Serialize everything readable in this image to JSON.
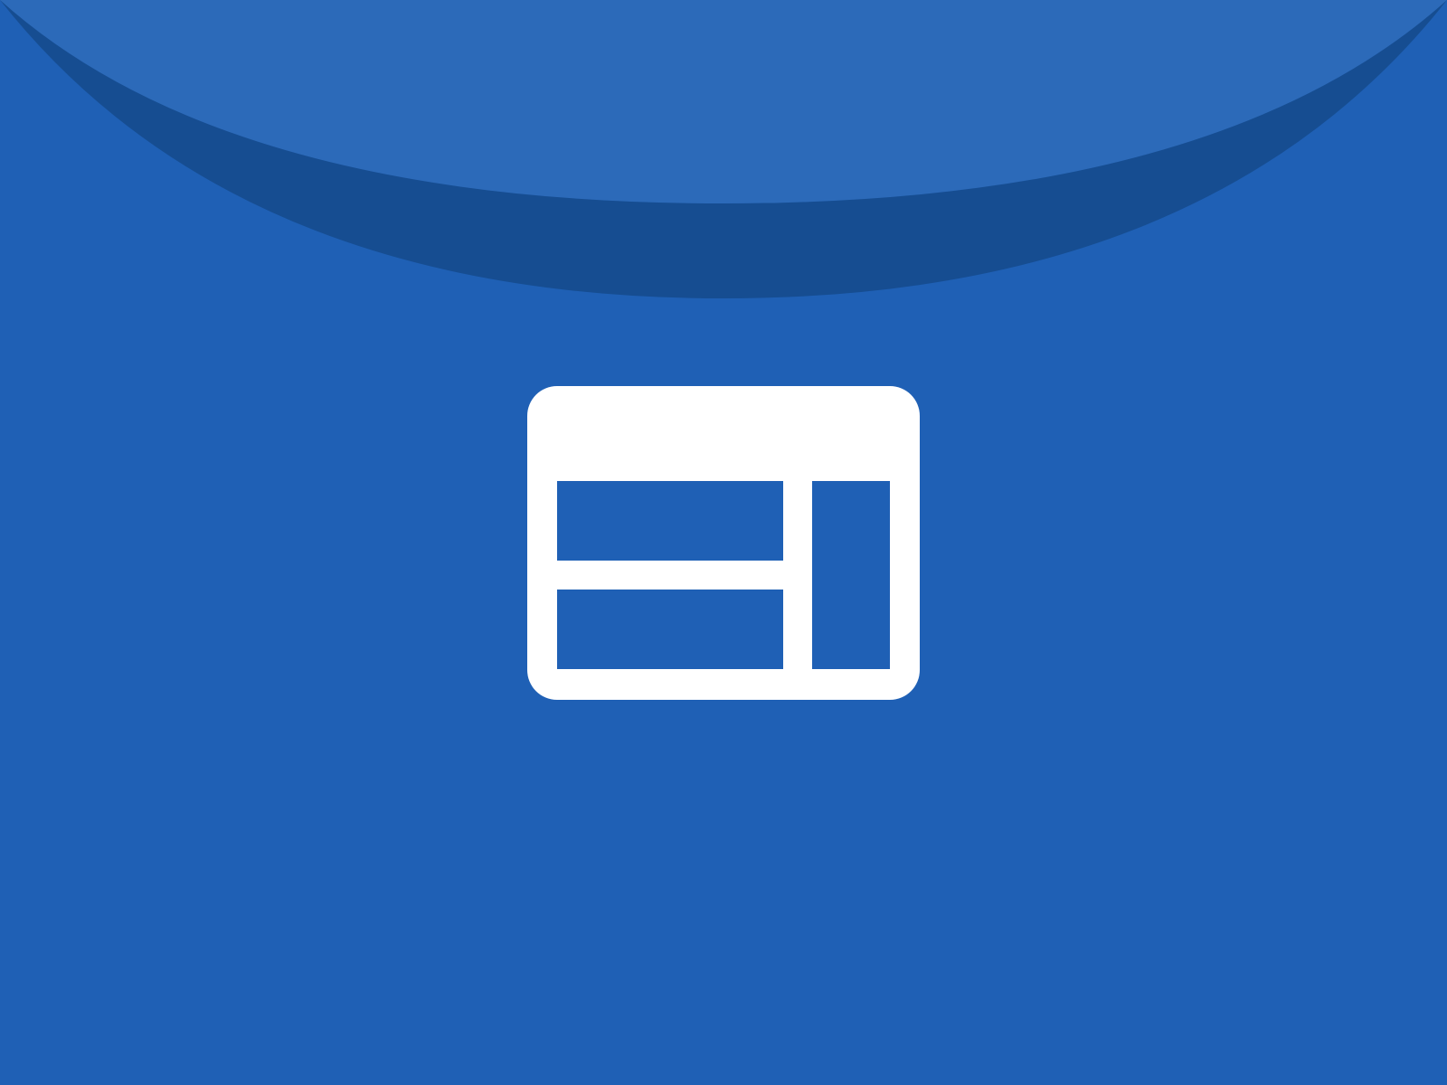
{
  "screen": {
    "kind": "app-splash",
    "icon": "web-layout-icon"
  },
  "colors": {
    "background": "#1F60B5",
    "swoosh_shadow": "#164D91",
    "swoosh_highlight": "#2C6AB9",
    "icon": "#FFFFFF"
  }
}
